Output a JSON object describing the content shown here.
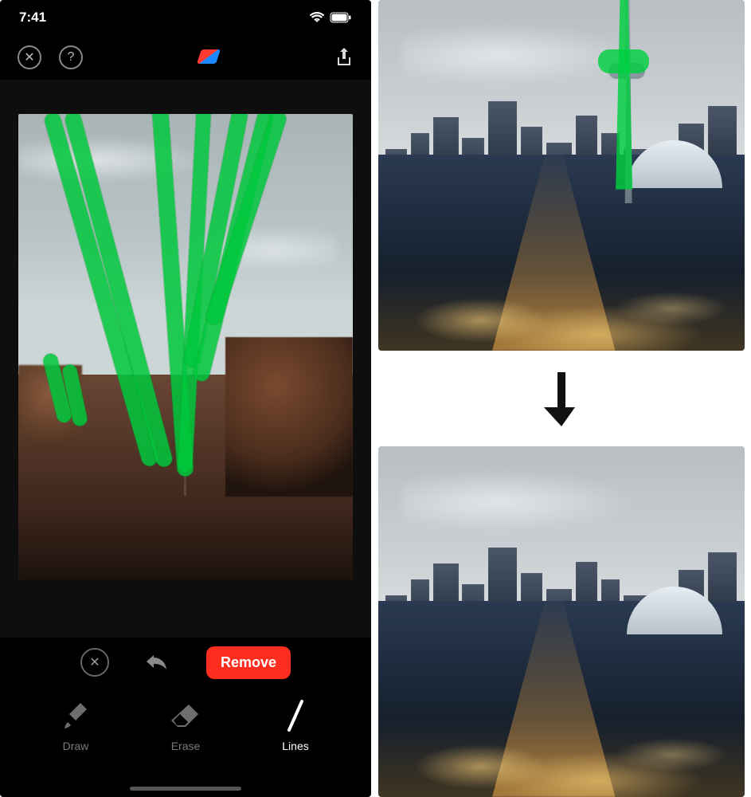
{
  "status": {
    "time": "7:41"
  },
  "topbar": {
    "close_label": "✕",
    "help_label": "?"
  },
  "actions": {
    "cancel_label": "✕",
    "remove_label": "Remove"
  },
  "tools": {
    "draw": "Draw",
    "erase": "Erase",
    "lines": "Lines",
    "active": "lines"
  },
  "marker_color": "#00c83c"
}
